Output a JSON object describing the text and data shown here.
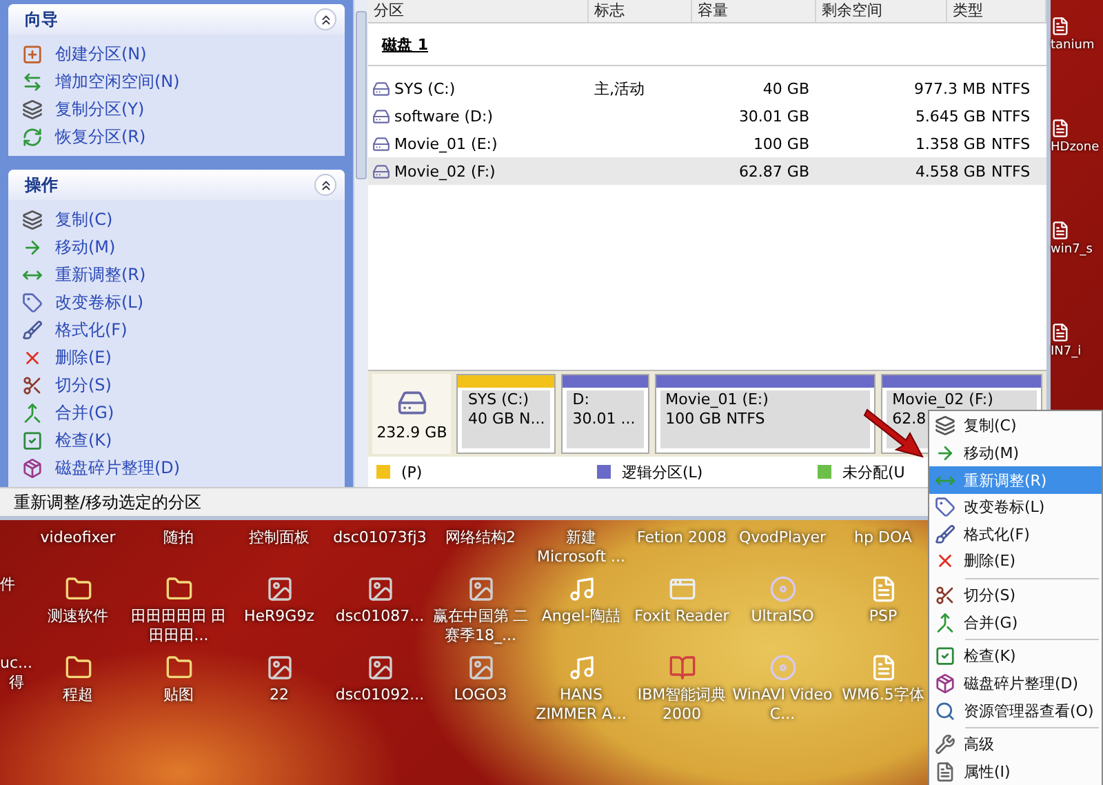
{
  "window": {
    "sidebar": {
      "sections": [
        {
          "title": "向导",
          "expanded": true,
          "items": [
            {
              "label": "创建分区(N)",
              "kind": "create"
            },
            {
              "label": "增加空闲空间(N)",
              "kind": "addspace"
            },
            {
              "label": "复制分区(Y)",
              "kind": "copy"
            },
            {
              "label": "恢复分区(R)",
              "kind": "restore"
            }
          ]
        },
        {
          "title": "操作",
          "expanded": true,
          "items": [
            {
              "label": "复制(C)",
              "kind": "copy"
            },
            {
              "label": "移动(M)",
              "kind": "move"
            },
            {
              "label": "重新调整(R)",
              "kind": "resize"
            },
            {
              "label": "改变卷标(L)",
              "kind": "label"
            },
            {
              "label": "格式化(F)",
              "kind": "format"
            },
            {
              "label": "删除(E)",
              "kind": "delete"
            },
            {
              "label": "切分(S)",
              "kind": "split"
            },
            {
              "label": "合并(G)",
              "kind": "merge"
            },
            {
              "label": "检查(K)",
              "kind": "check"
            },
            {
              "label": "磁盘碎片整理(D)",
              "kind": "defrag"
            }
          ]
        }
      ]
    },
    "partition_table": {
      "columns": [
        "分区",
        "标志",
        "容量",
        "剩余空间",
        "类型"
      ],
      "disk": "磁盘 1",
      "rows": [
        {
          "name": "SYS (C:)",
          "flag": "主,活动",
          "capacity": "40 GB",
          "free": "977.3 MB",
          "type": "NTFS",
          "selected": false
        },
        {
          "name": "software (D:)",
          "capacity": "30.01 GB",
          "free": "5.645 GB",
          "type": "NTFS",
          "selected": false
        },
        {
          "name": "Movie_01 (E:)",
          "capacity": "100 GB",
          "free": "1.358 GB",
          "type": "NTFS",
          "selected": false
        },
        {
          "name": "Movie_02 (F:)",
          "capacity": "62.87 GB",
          "free": "4.558 GB",
          "type": "NTFS",
          "selected": true
        }
      ]
    },
    "disk_map": {
      "size": "232.9 GB",
      "partitions": [
        {
          "line1": "SYS (C:)",
          "line2": "40 GB  N...",
          "color": "#f2c21b"
        },
        {
          "line1": "D:",
          "line2": "30.01 ...",
          "color": "#6a6ac8"
        },
        {
          "line1": "Movie_01 (E:)",
          "line2": "100 GB  NTFS",
          "color": "#6a6ac8"
        },
        {
          "line1": "Movie_02 (F:)",
          "line2": "62.8",
          "color": "#6a6ac8"
        }
      ]
    },
    "legend": [
      {
        "label": "(P)",
        "color": "#f2c21b"
      },
      {
        "label": "逻辑分区(L)",
        "color": "#6a6ac8"
      },
      {
        "label": "未分配(U",
        "color": "#6cc04a"
      }
    ],
    "status_bar": "重新调整/移动选定的分区"
  },
  "desktop": {
    "edge_labels": [
      "tanium",
      "HDzone",
      "win7_s",
      "IN7_i"
    ],
    "rows": [
      [
        {
          "kind": "none"
        },
        {
          "kind": "none",
          "label": "videofixer"
        },
        {
          "kind": "none",
          "label": "随拍"
        },
        {
          "kind": "none",
          "label": "控制面板"
        },
        {
          "kind": "none",
          "label": "dsc01073fj3"
        },
        {
          "kind": "none",
          "label": "网络结构2"
        },
        {
          "kind": "none",
          "label": "新建 Microsoft ..."
        },
        {
          "kind": "none",
          "label": "Fetion 2008"
        },
        {
          "kind": "none",
          "label": "QvodPlayer"
        },
        {
          "kind": "none",
          "label": "hp DOA"
        }
      ],
      [
        {
          "kind": "none",
          "label": "件"
        },
        {
          "kind": "folder",
          "label": "测速软件"
        },
        {
          "kind": "folder",
          "label": "田田田田田 田田田田..."
        },
        {
          "kind": "image",
          "label": "HeR9G9z"
        },
        {
          "kind": "image",
          "label": "dsc01087..."
        },
        {
          "kind": "image",
          "label": "赢在中国第 二赛季18_..."
        },
        {
          "kind": "audio",
          "label": "Angel-陶喆"
        },
        {
          "kind": "app",
          "label": "Foxit Reader"
        },
        {
          "kind": "disc",
          "label": "UltraISO"
        },
        {
          "kind": "file",
          "label": "PSP"
        }
      ],
      [
        {
          "kind": "none",
          "label": "uc... 得"
        },
        {
          "kind": "folder",
          "label": "程超"
        },
        {
          "kind": "folder",
          "label": "贴图"
        },
        {
          "kind": "image",
          "label": "22"
        },
        {
          "kind": "image",
          "label": "dsc01092..."
        },
        {
          "kind": "image",
          "label": "LOGO3"
        },
        {
          "kind": "audio",
          "label": "HANS ZIMMER A..."
        },
        {
          "kind": "book",
          "label": "IBM智能词典2000"
        },
        {
          "kind": "disc",
          "label": "WinAVI Video C..."
        },
        {
          "kind": "file",
          "label": "WM6.5字体"
        }
      ]
    ]
  },
  "context_menu": {
    "items": [
      {
        "kind": "copy",
        "label": "复制(C)",
        "selected": false
      },
      {
        "kind": "move",
        "label": "移动(M)",
        "selected": false
      },
      {
        "kind": "resize",
        "label": "重新调整(R)",
        "selected": true
      },
      {
        "kind": "label",
        "label": "改变卷标(L)",
        "selected": false
      },
      {
        "kind": "format",
        "label": "格式化(F)",
        "selected": false
      },
      {
        "kind": "delete",
        "label": "删除(E)",
        "selected": false
      },
      {
        "kind": "separator"
      },
      {
        "kind": "split",
        "label": "切分(S)",
        "selected": false
      },
      {
        "kind": "merge",
        "label": "合并(G)",
        "selected": false
      },
      {
        "kind": "separator"
      },
      {
        "kind": "check",
        "label": "检查(K)",
        "selected": false
      },
      {
        "kind": "defrag",
        "label": "磁盘碎片整理(D)",
        "selected": false
      },
      {
        "kind": "explore",
        "label": "资源管理器查看(O)",
        "selected": false
      },
      {
        "kind": "separator"
      },
      {
        "kind": "advanced",
        "label": "高级",
        "selected": false
      },
      {
        "kind": "properties",
        "label": "属性(I)",
        "selected": false
      }
    ]
  }
}
